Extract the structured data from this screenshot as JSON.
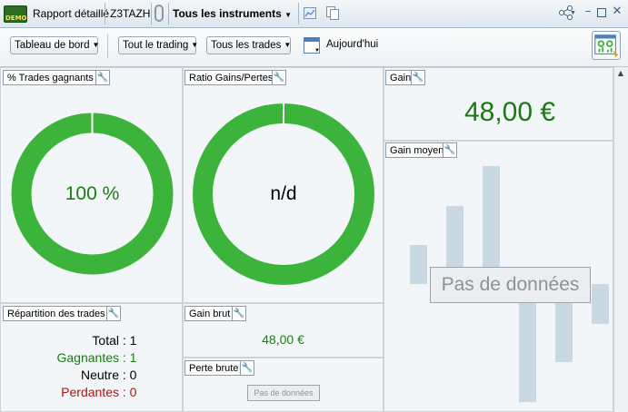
{
  "titlebar": {
    "demo_badge": "DEMO",
    "report_label": "Rapport détaillé",
    "account": "Z3TAZH",
    "instruments": "Tous les instruments"
  },
  "toolbar": {
    "view_dropdown": "Tableau de bord",
    "trading_dropdown": "Tout le trading",
    "trades_dropdown": "Tous les trades",
    "date_label": "Aujourd'hui"
  },
  "panels": {
    "winning_trades": {
      "title": "% Trades gagnants",
      "value": "100 %",
      "win_fraction": 1.0
    },
    "gain_loss_ratio": {
      "title": "Ratio Gains/Pertes",
      "value": "n/d",
      "fraction": 1.0
    },
    "gain": {
      "title": "Gain",
      "value": "48,00 €"
    },
    "avg_gain": {
      "title": "Gain moyen",
      "no_data": "Pas de données"
    },
    "distribution": {
      "title": "Répartition des trades",
      "rows": [
        {
          "label": "Total",
          "value": "1",
          "color": "#000000"
        },
        {
          "label": "Gagnantes",
          "value": "1",
          "color": "#1b7a14"
        },
        {
          "label": "Neutre",
          "value": "0",
          "color": "#000000"
        },
        {
          "label": "Perdantes",
          "value": "0",
          "color": "#a01818"
        }
      ]
    },
    "gross_gain": {
      "title": "Gain brut",
      "value": "48,00 €"
    },
    "gross_loss": {
      "title": "Perte brute",
      "no_data": "Pas de données"
    }
  },
  "colors": {
    "donut": "#3cb43c",
    "positive": "#1b7a14",
    "negative": "#a01818"
  }
}
